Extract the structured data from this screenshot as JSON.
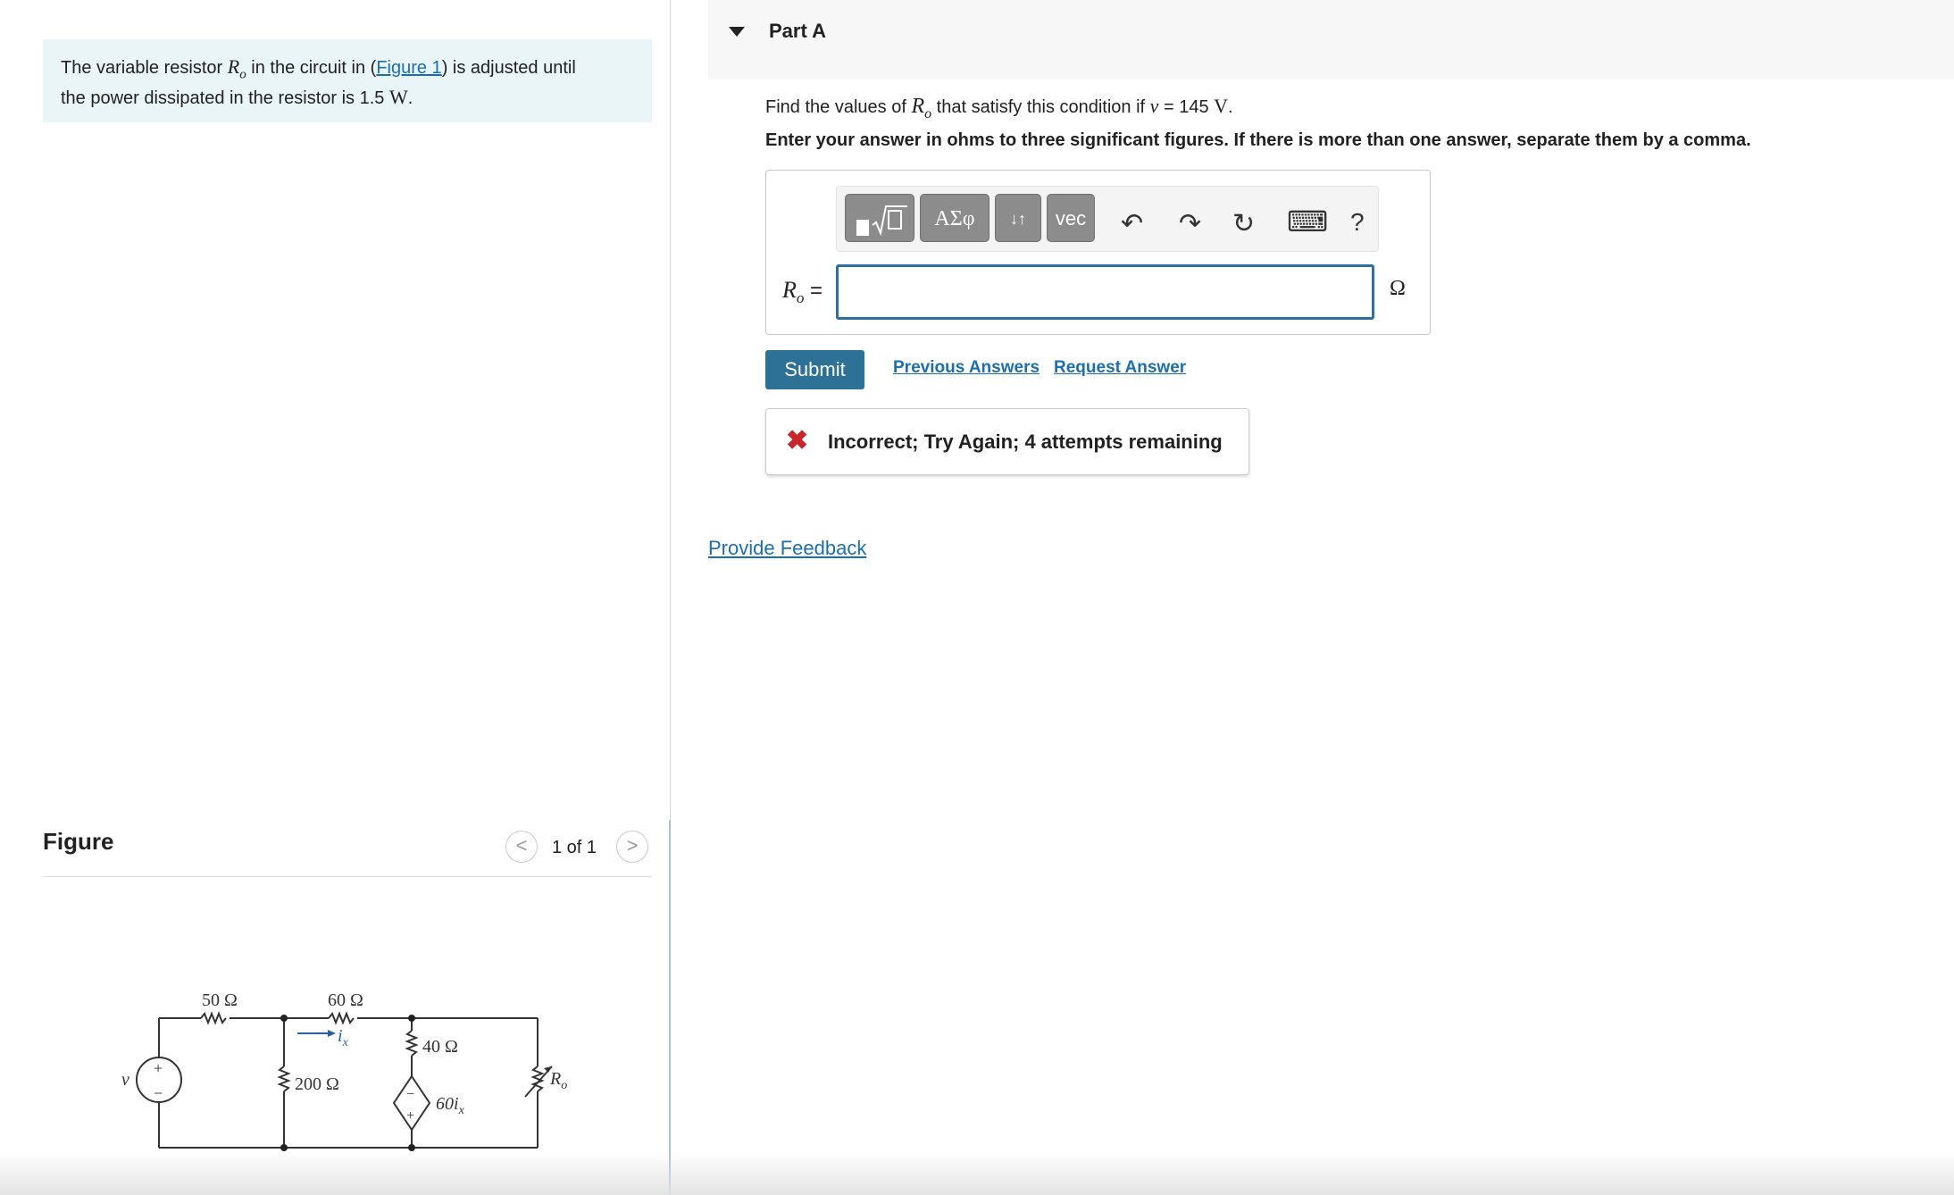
{
  "problem": {
    "text_before": "The variable resistor ",
    "var": "R",
    "var_sub": "o",
    "text_mid": " in the circuit in (",
    "figure_link": "Figure 1",
    "text_after": ") is adjusted until",
    "line2": "the power dissipated in the resistor is 1.5 ",
    "unit_w": "W",
    "period": "."
  },
  "figure": {
    "title": "Figure",
    "pager": "1 of 1",
    "prev": "<",
    "next": ">",
    "labels": {
      "r50": "50 Ω",
      "r60": "60 Ω",
      "r40": "40 Ω",
      "r200": "200 Ω",
      "dep": "60i",
      "dep_sub": "x",
      "ix": "i",
      "ix_sub": "x",
      "ro": "R",
      "ro_sub": "o",
      "v": "v",
      "plus": "+",
      "minus": "−"
    }
  },
  "part": {
    "title": "Part A",
    "question_pre": "Find the values of ",
    "q_var": "R",
    "q_var_sub": "o",
    "question_mid": " that satisfy this condition if ",
    "q_v": "v",
    "q_eq": " = 145 ",
    "q_unit": "V",
    "q_period": ".",
    "instruction": "Enter your answer in ohms to three significant figures. If there is more than one answer, separate them by a comma."
  },
  "toolbar": {
    "templates_icon": "sqrt-template-icon",
    "greek": "ΑΣφ",
    "arrows": "↓↑",
    "vec": "vec",
    "undo": "↶",
    "redo": "↷",
    "reset": "↻",
    "keyboard": "⌨",
    "help": "?"
  },
  "answer": {
    "label_var": "R",
    "label_sub": "o",
    "label_eq": " =",
    "value": "",
    "unit": "Ω"
  },
  "actions": {
    "submit": "Submit",
    "previous": "Previous Answers",
    "request": "Request Answer"
  },
  "feedback": {
    "icon": "✖",
    "text": "Incorrect; Try Again; 4 attempts remaining",
    "color": "#c9252b"
  },
  "provide_feedback": "Provide Feedback"
}
